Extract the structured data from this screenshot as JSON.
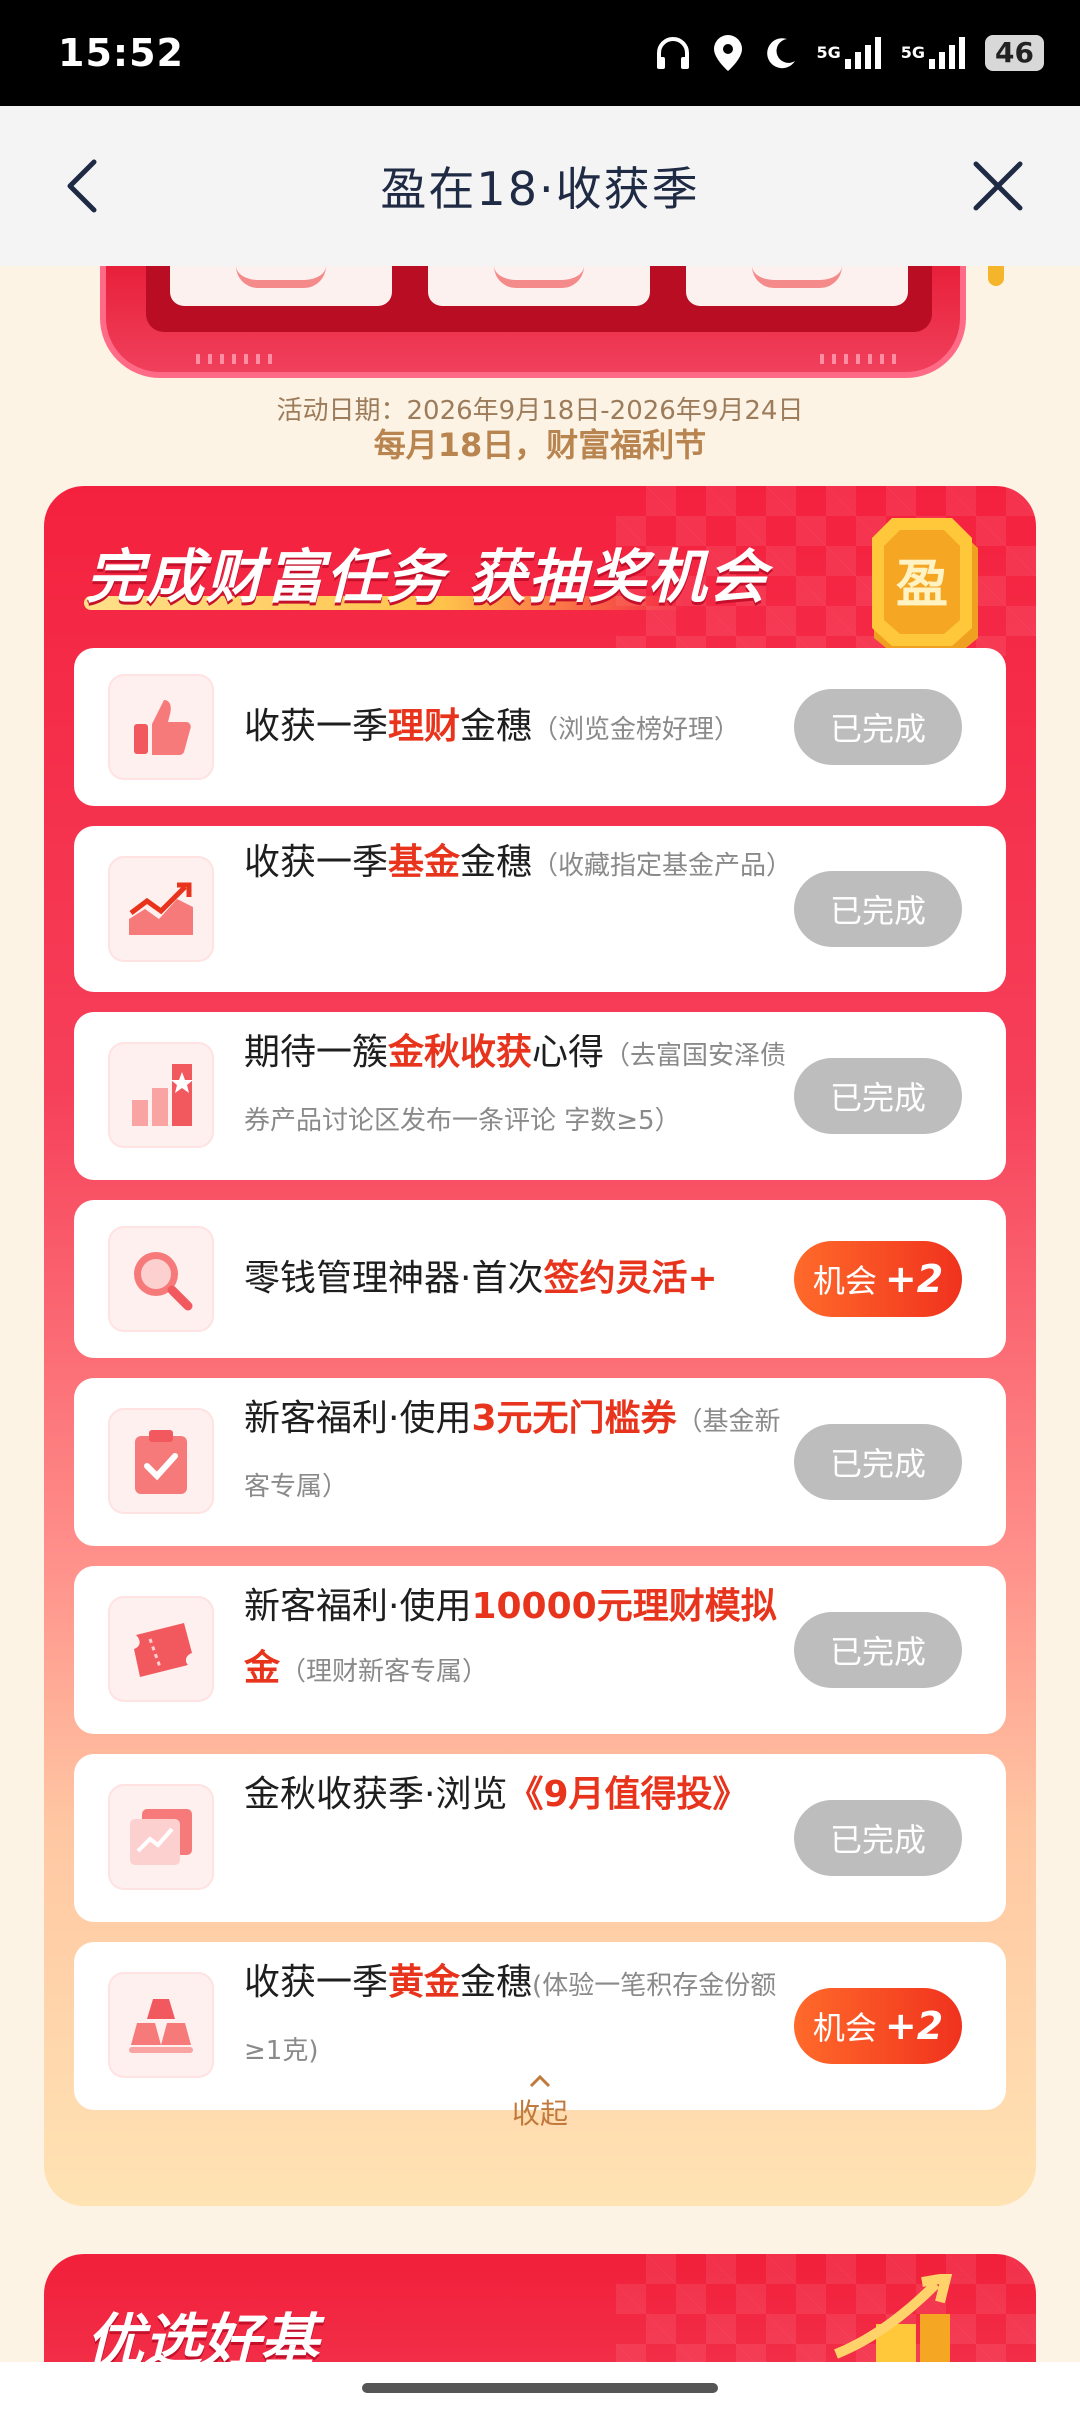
{
  "status_bar": {
    "time": "15:52",
    "signal1_label": "5G",
    "signal2_label": "5G",
    "battery": "46",
    "icons": [
      "headphones-icon",
      "location-icon",
      "moon-icon",
      "signal-icon",
      "signal-icon",
      "battery-icon"
    ]
  },
  "nav": {
    "title": "盈在18·收获季",
    "back_icon": "chevron-left-icon",
    "close_icon": "close-icon"
  },
  "activity": {
    "date": "活动日期：2026年9月18日-2026年9月24日",
    "slogan": "每月18日，财富福利节"
  },
  "task_panel": {
    "title": "完成财富任务 获抽奖机会",
    "coin_char": "盈",
    "tasks": [
      {
        "prefix": "收获一季",
        "highlight": "理财",
        "suffix": "金穗",
        "note": "（浏览金榜好理）",
        "button": "已完成",
        "state": "done",
        "icon": "thumbs-up-icon"
      },
      {
        "prefix": "收获一季",
        "highlight": "基金",
        "suffix": "金穗",
        "note": "（收藏指定基金产品）",
        "button": "已完成",
        "state": "done",
        "icon": "trend-chart-icon"
      },
      {
        "prefix": "期待一簇",
        "highlight": "金秋收获",
        "suffix": "心得",
        "note": "（去富国安泽债券产品讨论区发布一条评论 字数≥5）",
        "button": "已完成",
        "state": "done",
        "icon": "ranking-chart-icon"
      },
      {
        "prefix": "零钱管理神器·首次",
        "highlight": "签约灵活+",
        "suffix": "",
        "note": "",
        "button_label": "机会",
        "button_bonus": "+2",
        "state": "chance",
        "icon": "magnifier-icon"
      },
      {
        "prefix": "新客福利·使用",
        "highlight": "3元无门槛券",
        "suffix": "",
        "note": "（基金新客专属）",
        "button": "已完成",
        "state": "done",
        "icon": "clipboard-check-icon"
      },
      {
        "prefix": "新客福利·使用",
        "highlight": "10000元理财模拟金",
        "suffix": "",
        "note": "（理财新客专属）",
        "button": "已完成",
        "state": "done",
        "icon": "ticket-icon"
      },
      {
        "prefix": "金秋收获季·浏览",
        "highlight": "《9月值得投》",
        "suffix": "",
        "note": "",
        "button": "已完成",
        "state": "done",
        "icon": "growth-card-icon"
      },
      {
        "prefix": "收获一季",
        "highlight": "黄金",
        "suffix": "金穗",
        "note": "(体验一笔积存金份额≥1克)",
        "button_label": "机会",
        "button_bonus": "+2",
        "state": "chance",
        "icon": "gold-bars-icon"
      }
    ],
    "collapse_label": "收起"
  },
  "bottom_panel": {
    "title": "优选好基"
  },
  "colors": {
    "accent_red": "#f4213e",
    "highlight_text": "#e8341c",
    "done_button": "#bdbdbd",
    "chance_button": "#f0321e"
  }
}
